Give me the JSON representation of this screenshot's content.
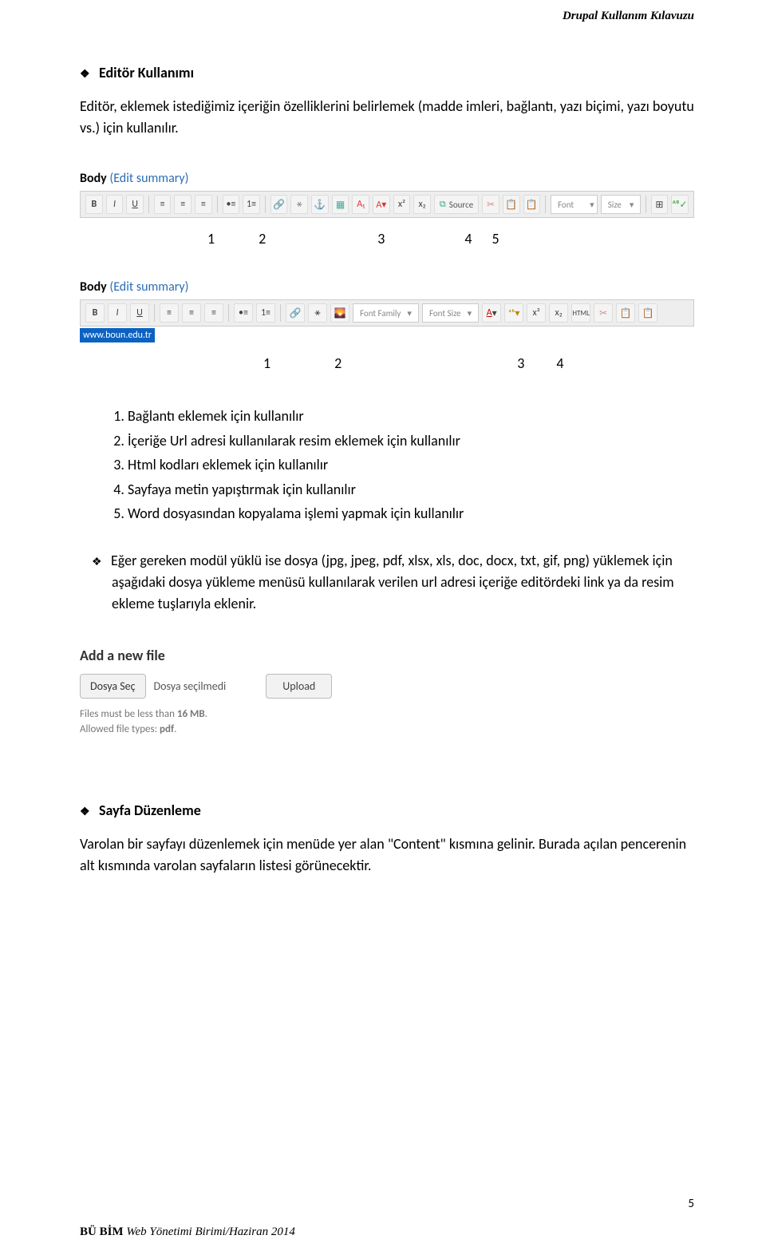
{
  "header": {
    "doc_title": "Drupal Kullanım Kılavuzu"
  },
  "section1": {
    "title": "Editör Kullanımı",
    "intro": "Editör, eklemek istediğimiz içeriğin özelliklerini belirlemek (madde imleri, bağlantı, yazı biçimi, yazı boyutu vs.) için kullanılır."
  },
  "editor1": {
    "body_label_bold": "Body",
    "body_label_link": "(Edit summary)",
    "font_placeholder": "Font",
    "size_placeholder": "Size",
    "source_label": "Source"
  },
  "numbers1": {
    "n1": "1",
    "n2": "2",
    "n3": "3",
    "n4": "4",
    "n5": "5"
  },
  "editor2": {
    "body_label_bold": "Body",
    "body_label_link": "(Edit summary)",
    "font_family": "Font Family",
    "font_size": "Font Size",
    "url": "www.boun.edu.tr"
  },
  "numbers2": {
    "n1": "1",
    "n2": "2",
    "n3": "3",
    "n4": "4"
  },
  "list": {
    "i1": "Bağlantı eklemek için kullanılır",
    "i2": "İçeriğe Url adresi kullanılarak resim eklemek için kullanılır",
    "i3": "Html kodları eklemek için kullanılır",
    "i4": "Sayfaya metin yapıştırmak için kullanılır",
    "i5": "Word dosyasından kopyalama işlemi yapmak için kullanılır"
  },
  "paragraph2": "Eğer gereken modül yüklü ise dosya (jpg, jpeg, pdf, xlsx, xls, doc, docx, txt, gif, png) yüklemek için aşağıdaki dosya yükleme menüsü kullanılarak verilen url adresi içeriğe editördeki link ya da resim ekleme tuşlarıyla eklenir.",
  "upload": {
    "title": "Add a new file",
    "choose": "Dosya Seç",
    "status": "Dosya seçilmedi",
    "upload_btn": "Upload",
    "info1a": "Files must be less than ",
    "info1b": "16 MB",
    "info1c": ".",
    "info2a": "Allowed file types: ",
    "info2b": "pdf",
    "info2c": "."
  },
  "section2": {
    "title": "Sayfa Düzenleme",
    "text": "Varolan bir sayfayı düzenlemek için menüde yer alan \"Content\" kısmına gelinir. Burada açılan pencerenin alt kısmında varolan sayfaların listesi görünecektir."
  },
  "page_number": "5",
  "footer": {
    "bold": "BÜ BİM",
    "rest": " Web Yönetimi Birimi/Haziran 2014"
  }
}
